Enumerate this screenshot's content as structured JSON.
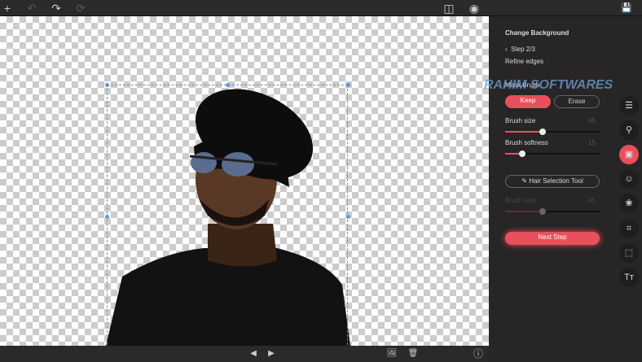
{
  "toolbar": {
    "add": "+",
    "undo": "↶",
    "redo": "↷",
    "reset": "⟳",
    "compare": "◫",
    "preview": "◉",
    "save": "💾"
  },
  "panel": {
    "title": "Change Background",
    "step": "Step 2/3",
    "subtitle": "Refine edges",
    "mask_brush_label": "Mask Brush",
    "keep_label": "Keep",
    "erase_label": "Erase",
    "brush_size_label": "Brush size",
    "brush_size_value": "45",
    "brush_softness_label": "Brush softness",
    "brush_softness_value": "15",
    "hair_tool_label": "Hair Selection Tool",
    "hair_brush_size_label": "Brush size",
    "hair_brush_size_value": "45",
    "next_label": "Next Step",
    "watermark": "RAHIM SOFTWARES"
  },
  "sliders": {
    "brush_size": 0.4,
    "brush_softness": 0.18,
    "hair_brush_size": 0.4
  },
  "colors": {
    "accent": "#e8505b"
  },
  "bottom": {
    "prev": "◀",
    "next": "▶",
    "image": "🖼",
    "delete": "🗑",
    "info": "ⓘ"
  }
}
